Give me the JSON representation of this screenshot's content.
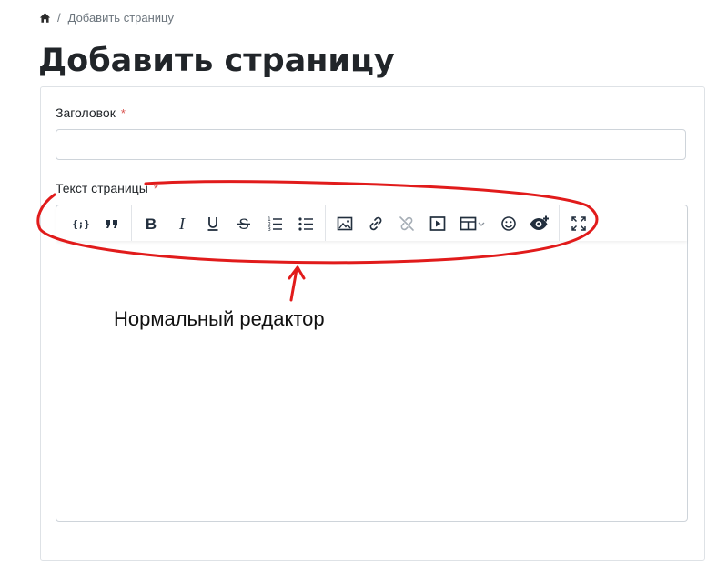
{
  "breadcrumb": {
    "current": "Добавить страницу"
  },
  "page": {
    "title": "Добавить страницу"
  },
  "form": {
    "title_field": {
      "label": "Заголовок",
      "required_mark": "*",
      "value": "",
      "placeholder": ""
    },
    "body_field": {
      "label": "Текст страницы",
      "required_mark": "*"
    }
  },
  "toolbar": {
    "groups": [
      [
        "code-sample",
        "blockquote"
      ],
      [
        "bold",
        "italic",
        "underline",
        "strikethrough",
        "numbered-list",
        "bulleted-list"
      ],
      [
        "image",
        "link",
        "unlink",
        "media",
        "table",
        "emoticons",
        "preview"
      ],
      [
        "fullscreen"
      ]
    ]
  },
  "annotation": {
    "text": "Нормальный редактор",
    "color": "#e11b1b"
  }
}
